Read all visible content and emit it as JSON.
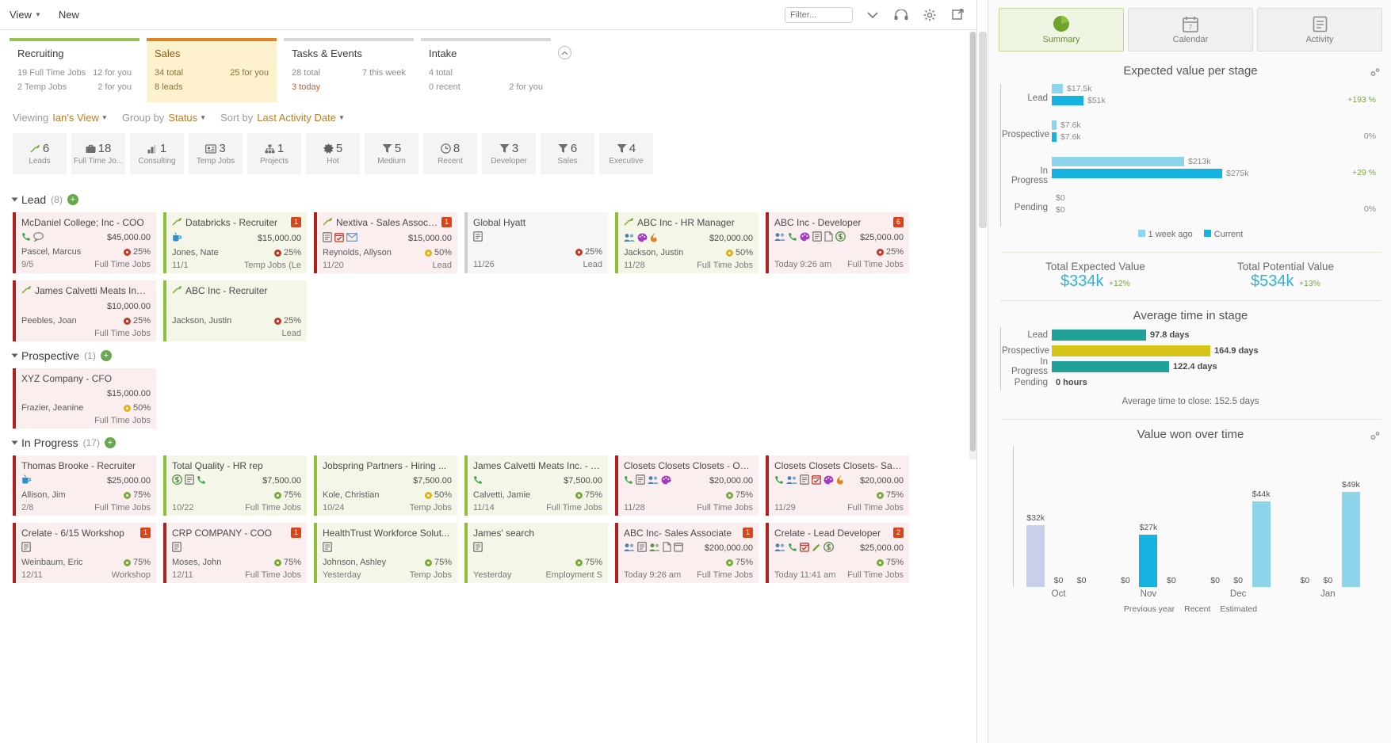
{
  "topbar": {
    "menu": [
      {
        "label": "View",
        "has_caret": true,
        "name": "view-menu"
      },
      {
        "label": "New",
        "has_caret": false,
        "name": "new-menu"
      }
    ],
    "filter_placeholder": "Filter...",
    "icons": [
      "chevron-down-icon",
      "headset-icon",
      "gear-icon",
      "export-icon"
    ]
  },
  "tiles": [
    {
      "title": "Recruiting",
      "accent": "#9ac255",
      "rows": [
        {
          "left": "19 Full Time Jobs",
          "right": "12 for you"
        },
        {
          "left": "2 Temp Jobs",
          "right": "2 for you"
        }
      ]
    },
    {
      "title": "Sales",
      "accent": "#e08421",
      "rows": [
        {
          "left": "34 total",
          "right": "25 for you"
        },
        {
          "left": "8 leads",
          "right": ""
        }
      ]
    },
    {
      "title": "Tasks & Events",
      "accent": "#d8d8d8",
      "rows": [
        {
          "left": "28 total",
          "right": "7 this week"
        },
        {
          "left": "3 today",
          "right": "",
          "alert": true
        }
      ]
    },
    {
      "title": "Intake",
      "accent": "#d8d8d8",
      "rows": [
        {
          "left": "4 total",
          "right": ""
        },
        {
          "left": "0 recent",
          "right": "2 for you"
        }
      ]
    }
  ],
  "viewbar": {
    "viewing_label": "Viewing",
    "viewing_value": "Ian's View",
    "group_label": "Group by",
    "group_value": "Status",
    "sort_label": "Sort by",
    "sort_value": "Last Activity Date"
  },
  "chips": [
    {
      "icon": "lead-sprout-icon",
      "count": "6",
      "label": "Leads"
    },
    {
      "icon": "briefcase-icon",
      "count": "18",
      "label": "Full Time Jo..."
    },
    {
      "icon": "bar-chart-icon",
      "count": "1",
      "label": "Consulting"
    },
    {
      "icon": "id-card-icon",
      "count": "3",
      "label": "Temp Jobs"
    },
    {
      "icon": "org-chart-icon",
      "count": "1",
      "label": "Projects"
    },
    {
      "icon": "sun-burst-icon",
      "count": "5",
      "label": "Hot"
    },
    {
      "icon": "funnel-icon",
      "count": "5",
      "label": "Medium"
    },
    {
      "icon": "clock-icon",
      "count": "8",
      "label": "Recent"
    },
    {
      "icon": "funnel-icon",
      "count": "3",
      "label": "Developer"
    },
    {
      "icon": "funnel-icon",
      "count": "6",
      "label": "Sales"
    },
    {
      "icon": "funnel-icon",
      "count": "4",
      "label": "Executive"
    }
  ],
  "groups": [
    {
      "name": "Lead",
      "count": "(8)",
      "cards": [
        {
          "title": "McDaniel College; Inc - COO",
          "style": "red",
          "badge": "",
          "icons": [
            "phone-icon",
            "chat-icon"
          ],
          "amount": "$45,000.00",
          "person": "Pascel, Marcus",
          "pct": "25%",
          "pct_color": "red",
          "date": "9/5",
          "type": "Full Time Jobs",
          "lead_icon": false
        },
        {
          "title": "Databricks - Recruiter",
          "style": "green",
          "badge": "1",
          "icons": [
            "cup-icon"
          ],
          "amount": "$15,000.00",
          "person": "Jones, Nate",
          "pct": "25%",
          "pct_color": "red",
          "date": "11/1",
          "type": "Temp Jobs (Le",
          "lead_icon": true
        },
        {
          "title": "Nextiva - Sales Associate",
          "style": "red",
          "badge": "1",
          "icons": [
            "note-icon",
            "calendar-check-icon",
            "mail-icon"
          ],
          "amount": "$15,000.00",
          "person": "Reynolds, Allyson",
          "pct": "50%",
          "pct_color": "yellow",
          "date": "11/20",
          "type": "Lead",
          "lead_icon": true
        },
        {
          "title": "Global Hyatt",
          "style": "gray",
          "badge": "",
          "icons": [
            "note-icon"
          ],
          "amount": "",
          "person": "",
          "pct": "25%",
          "pct_color": "red",
          "date": "11/26",
          "type": "Lead",
          "lead_icon": false
        },
        {
          "title": "ABC Inc - HR Manager",
          "style": "green",
          "badge": "",
          "icons": [
            "people-icon",
            "palette-icon",
            "fire-icon"
          ],
          "amount": "$20,000.00",
          "person": "Jackson, Justin",
          "pct": "50%",
          "pct_color": "yellow",
          "date": "11/28",
          "type": "Full Time Jobs",
          "lead_icon": true
        },
        {
          "title": "ABC Inc - Developer",
          "style": "red",
          "badge": "6",
          "icons": [
            "people-icon",
            "phone-icon",
            "palette-icon",
            "note-icon",
            "doc-icon",
            "money-icon"
          ],
          "amount": "$25,000.00",
          "person": "",
          "pct": "25%",
          "pct_color": "red",
          "date": "Today 9:26 am",
          "type": "Full Time Jobs",
          "lead_icon": false
        },
        {
          "title": "James Calvetti Meats Inc....",
          "style": "red",
          "badge": "",
          "icons": [],
          "amount": "$10,000.00",
          "person": "Peebles, Joan",
          "pct": "25%",
          "pct_color": "red",
          "date": "",
          "type": "Full Time Jobs",
          "lead_icon": true
        },
        {
          "title": "ABC Inc - Recruiter",
          "style": "green",
          "badge": "",
          "icons": [],
          "amount": "",
          "person": "Jackson, Justin",
          "pct": "25%",
          "pct_color": "red",
          "date": "",
          "type": "Lead",
          "lead_icon": true
        }
      ]
    },
    {
      "name": "Prospective",
      "count": "(1)",
      "cards": [
        {
          "title": "XYZ Company - CFO",
          "style": "red",
          "badge": "",
          "icons": [],
          "amount": "$15,000.00",
          "person": "Frazier, Jeanine",
          "pct": "50%",
          "pct_color": "yellow",
          "date": "",
          "type": "Full Time Jobs",
          "lead_icon": false
        }
      ]
    },
    {
      "name": "In Progress",
      "count": "(17)",
      "cards": [
        {
          "title": "Thomas Brooke - Recruiter",
          "style": "red",
          "badge": "",
          "icons": [
            "cup-icon"
          ],
          "amount": "$25,000.00",
          "person": "Allison, Jim",
          "pct": "75%",
          "pct_color": "green",
          "date": "2/8",
          "type": "Full Time Jobs",
          "lead_icon": false
        },
        {
          "title": "Total Quality - HR rep",
          "style": "green",
          "badge": "",
          "icons": [
            "money-icon",
            "note-icon",
            "phone-icon"
          ],
          "amount": "$7,500.00",
          "person": "",
          "pct": "75%",
          "pct_color": "green",
          "date": "10/22",
          "type": "Full Time Jobs",
          "lead_icon": false
        },
        {
          "title": "Jobspring Partners - Hiring ...",
          "style": "green",
          "badge": "",
          "icons": [],
          "amount": "$7,500.00",
          "person": "Kole, Christian",
          "pct": "50%",
          "pct_color": "yellow",
          "date": "10/24",
          "type": "Temp Jobs",
          "lead_icon": false
        },
        {
          "title": "James Calvetti Meats Inc. - S...",
          "style": "green",
          "badge": "",
          "icons": [
            "phone-icon"
          ],
          "amount": "$7,500.00",
          "person": "Calvetti, Jamie",
          "pct": "75%",
          "pct_color": "green",
          "date": "11/14",
          "type": "Full Time Jobs",
          "lead_icon": false
        },
        {
          "title": "Closets Closets Closets - Op...",
          "style": "red",
          "badge": "",
          "icons": [
            "phone-icon",
            "note-icon",
            "people-icon",
            "palette-icon"
          ],
          "amount": "$20,000.00",
          "person": "",
          "pct": "75%",
          "pct_color": "green",
          "date": "11/28",
          "type": "Full Time Jobs",
          "lead_icon": false
        },
        {
          "title": "Closets Closets Closets- Sale...",
          "style": "red",
          "badge": "",
          "icons": [
            "phone-icon",
            "people-icon",
            "note-icon",
            "check-icon",
            "palette-icon",
            "fire-icon"
          ],
          "amount": "$20,000.00",
          "person": "",
          "pct": "75%",
          "pct_color": "green",
          "date": "11/29",
          "type": "Full Time Jobs",
          "lead_icon": false
        },
        {
          "title": "Crelate - 6/15 Workshop",
          "style": "red",
          "badge": "1",
          "icons": [
            "note-icon"
          ],
          "amount": "",
          "person": "Weinbaum, Eric",
          "pct": "75%",
          "pct_color": "green",
          "date": "12/11",
          "type": "Workshop",
          "lead_icon": false
        },
        {
          "title": "CRP COMPANY - COO",
          "style": "red",
          "badge": "1",
          "icons": [
            "note-icon"
          ],
          "amount": "",
          "person": "Moses, John",
          "pct": "75%",
          "pct_color": "green",
          "date": "12/11",
          "type": "Full Time Jobs",
          "lead_icon": false
        },
        {
          "title": "HealthTrust Workforce Solut...",
          "style": "green",
          "badge": "",
          "icons": [
            "note-icon"
          ],
          "amount": "",
          "person": "Johnson, Ashley",
          "pct": "75%",
          "pct_color": "green",
          "date": "Yesterday",
          "type": "Temp Jobs",
          "lead_icon": false
        },
        {
          "title": "James' search",
          "style": "green",
          "badge": "",
          "icons": [
            "note-icon"
          ],
          "amount": "",
          "person": "",
          "pct": "75%",
          "pct_color": "green",
          "date": "Yesterday",
          "type": "Employment S",
          "lead_icon": false
        },
        {
          "title": "ABC Inc- Sales Associate",
          "style": "red",
          "badge": "1",
          "icons": [
            "people-icon",
            "note-icon",
            "people2-icon",
            "doc-icon",
            "calendar-icon"
          ],
          "amount": "$200,000.00",
          "person": "",
          "pct": "75%",
          "pct_color": "green",
          "date": "Today 9:26 am",
          "type": "Full Time Jobs",
          "lead_icon": false
        },
        {
          "title": "Crelate - Lead Developer",
          "style": "red",
          "badge": "2",
          "icons": [
            "people-icon",
            "phone-icon",
            "check-icon",
            "pencil-icon",
            "money-icon"
          ],
          "amount": "$25,000.00",
          "person": "",
          "pct": "75%",
          "pct_color": "green",
          "date": "Today 11:41 am",
          "type": "Full Time Jobs",
          "lead_icon": false
        }
      ]
    }
  ],
  "rightpanel": {
    "tabs": [
      {
        "label": "Summary",
        "icon": "pie-chart-icon",
        "active": true
      },
      {
        "label": "Calendar",
        "icon": "calendar-icon",
        "active": false
      },
      {
        "label": "Activity",
        "icon": "activity-list-icon",
        "active": false
      }
    ],
    "totals": [
      {
        "label": "Total Expected Value",
        "value": "$334k",
        "delta": "+12%"
      },
      {
        "label": "Total Potential Value",
        "value": "$534k",
        "delta": "+13%"
      }
    ],
    "avg_time_note": "Average time to close: 152.5 days"
  },
  "chart_data": [
    {
      "type": "bar",
      "orientation": "horizontal",
      "title": "Expected value per stage",
      "categories": [
        "Lead",
        "Prospective",
        "In Progress",
        "Pending"
      ],
      "series": [
        {
          "name": "1 week ago",
          "color": "#8ed5ec",
          "values": [
            17500,
            7600,
            213000,
            0
          ],
          "labels": [
            "$17.5k",
            "$7.6k",
            "$213k",
            "$0"
          ]
        },
        {
          "name": "Current",
          "color": "#16b2e0",
          "values": [
            51000,
            7600,
            275000,
            0
          ],
          "labels": [
            "$51k",
            "$7.6k",
            "$275k",
            "$0"
          ]
        }
      ],
      "deltas": [
        "+193 %",
        "0%",
        "+29 %",
        "0%"
      ],
      "legend_position": "bottom",
      "xlabel": "",
      "ylabel": "",
      "grid": false
    },
    {
      "type": "bar",
      "orientation": "horizontal",
      "title": "Average time in stage",
      "categories": [
        "Lead",
        "Prospective",
        "In Progress",
        "Pending"
      ],
      "values": [
        97.8,
        164.9,
        122.4,
        0
      ],
      "value_labels": [
        "97.8 days",
        "164.9 days",
        "122.4 days",
        "0 hours"
      ],
      "colors": [
        "#21a19a",
        "#d6c519",
        "#21a19a",
        "#21a19a"
      ],
      "xlabel": "",
      "ylabel": "",
      "grid": false
    },
    {
      "type": "bar",
      "orientation": "vertical",
      "title": "Value won over time",
      "categories": [
        "Oct",
        "Nov",
        "Dec",
        "Jan"
      ],
      "series": [
        {
          "name": "Previous year",
          "color": "#c9ceea",
          "values": [
            32000,
            0,
            0,
            0
          ],
          "labels": [
            "$32k",
            "$0",
            "$0",
            "$0"
          ]
        },
        {
          "name": "Recent",
          "color": "#16b2e0",
          "values": [
            0,
            27000,
            0,
            0
          ],
          "labels": [
            "$0",
            "$27k",
            "$0",
            "$0"
          ]
        },
        {
          "name": "Estimated",
          "color": "#8ed5ec",
          "values": [
            0,
            0,
            44000,
            49000
          ],
          "labels": [
            "$0",
            "$0",
            "$44k",
            "$49k"
          ]
        }
      ],
      "legend_position": "bottom",
      "xlabel": "",
      "ylabel": "",
      "grid": false
    }
  ]
}
